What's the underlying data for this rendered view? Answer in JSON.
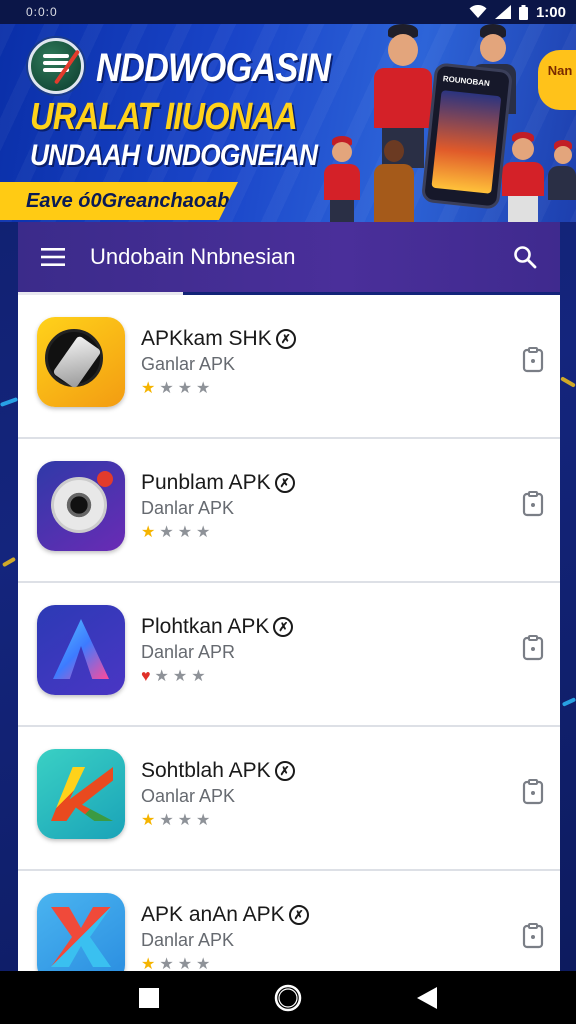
{
  "status_bar": {
    "left_text": "0:0:0",
    "time": "1:00"
  },
  "banner": {
    "title": "NDDWOGASIN",
    "line1": "URALAT IIUONAA",
    "line2": "UNDAAH UNDOGNEIAN",
    "ribbon": "Eave ó0Greanchaoab",
    "badge": "Nan",
    "phone_title": "ROUNOBAN"
  },
  "header": {
    "title": "Undobain Nnbnesian"
  },
  "apps": [
    {
      "name": "APKkam SHK",
      "subtitle": "Ganlar APK",
      "rating": 1,
      "rating_color": "#f5b400"
    },
    {
      "name": "Punblam APK",
      "subtitle": "Danlar APK",
      "rating": 1,
      "rating_color": "#f5b400"
    },
    {
      "name": "Plohtkan APK",
      "subtitle": "Danlar APR",
      "rating": 1,
      "rating_color": "#e03028"
    },
    {
      "name": "Sohtblah APK",
      "subtitle": "Oanlar APK",
      "rating": 1,
      "rating_color": "#f5b400"
    },
    {
      "name": "APK anAn APK",
      "subtitle": "Danlar APK",
      "rating": 1,
      "rating_color": "#f5b400"
    }
  ],
  "colors": {
    "header_bg": "#3b2b8a",
    "accent_yellow": "#ffcb14",
    "background": "#14257d"
  }
}
